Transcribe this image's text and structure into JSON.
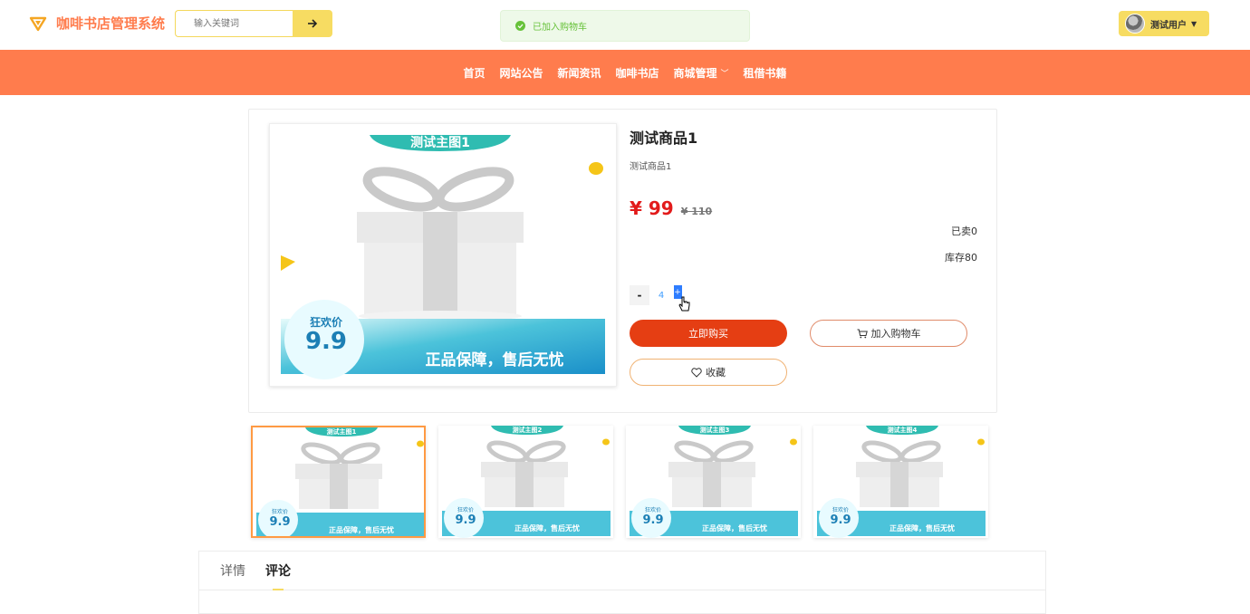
{
  "app": {
    "title": "咖啡书店管理系统",
    "search_placeholder": "输入关键词"
  },
  "toast": {
    "text": "已加入购物车"
  },
  "user": {
    "name": "测试用户"
  },
  "nav": {
    "items": [
      "首页",
      "网站公告",
      "新闻资讯",
      "咖啡书店",
      "商城管理",
      "租借书籍"
    ]
  },
  "product": {
    "title": "测试商品1",
    "subtitle": "测试商品1",
    "price": "¥ 99",
    "price_old": "¥ 110",
    "sold": "已卖0",
    "stock": "库存80",
    "quantity": "4",
    "minus_label": "-",
    "plus_label": "+",
    "buy_label": "立即购买",
    "cart_label": "加入购物车",
    "fav_label": "收藏"
  },
  "promo_image": {
    "main_banner": "测试主图1",
    "badge_top": "狂欢价",
    "badge_price": "9.9",
    "slogan": "正品保障，售后无忧"
  },
  "thumbnails": [
    {
      "banner": "测试主图1"
    },
    {
      "banner": "测试主图2"
    },
    {
      "banner": "测试主图3"
    },
    {
      "banner": "测试主图4"
    }
  ],
  "tabs": [
    "详情",
    "评论"
  ],
  "colors": {
    "brand": "#ff7c4d",
    "accent_yellow": "#f7dc62",
    "buy_button": "#e53e13",
    "price": "#e21b1b",
    "toast_green": "#67c23a"
  }
}
